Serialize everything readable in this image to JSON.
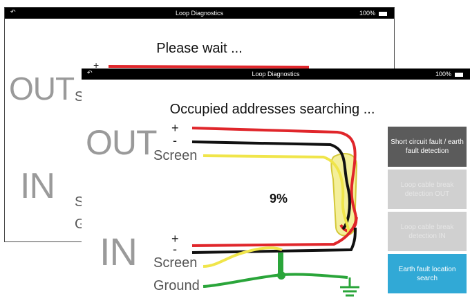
{
  "back_screen": {
    "status": {
      "back_icon": "↶",
      "title": "Loop Diagnostics",
      "battery": "100%"
    },
    "message": "Please wait ...",
    "out_label": "OUT",
    "out_screen_label": "Sc",
    "in_label": "IN",
    "in_screen_label": "Sc",
    "in_ground_label": "Gr",
    "plus": "+"
  },
  "front_screen": {
    "status": {
      "back_icon": "↶",
      "title": "Loop Diagnostics",
      "battery": "100%"
    },
    "message": "Occupied addresses searching ...",
    "out": {
      "label": "OUT",
      "plus": "+",
      "minus": "-",
      "screen": "Screen"
    },
    "in": {
      "label": "IN",
      "plus": "+",
      "minus": "-",
      "screen": "Screen",
      "ground": "Ground"
    },
    "progress_percent": "9%",
    "progress_value": 9,
    "buttons": [
      {
        "label": "Short circuit fault / earth fault detection",
        "state": "active",
        "color": "#5b5b5b"
      },
      {
        "label": "Loop cable break detection OUT",
        "state": "disabled",
        "color": "#d0d0d0"
      },
      {
        "label": "Loop cable break detection IN",
        "state": "disabled",
        "color": "#d0d0d0"
      },
      {
        "label": "Earth fault location search",
        "state": "active",
        "color": "#31a9d6"
      }
    ]
  },
  "colors": {
    "wire_red": "#e0262b",
    "wire_black": "#111111",
    "wire_yellow": "#f0e54a",
    "wire_green": "#2aa53a",
    "coil_fill": "#f4ef9a"
  }
}
